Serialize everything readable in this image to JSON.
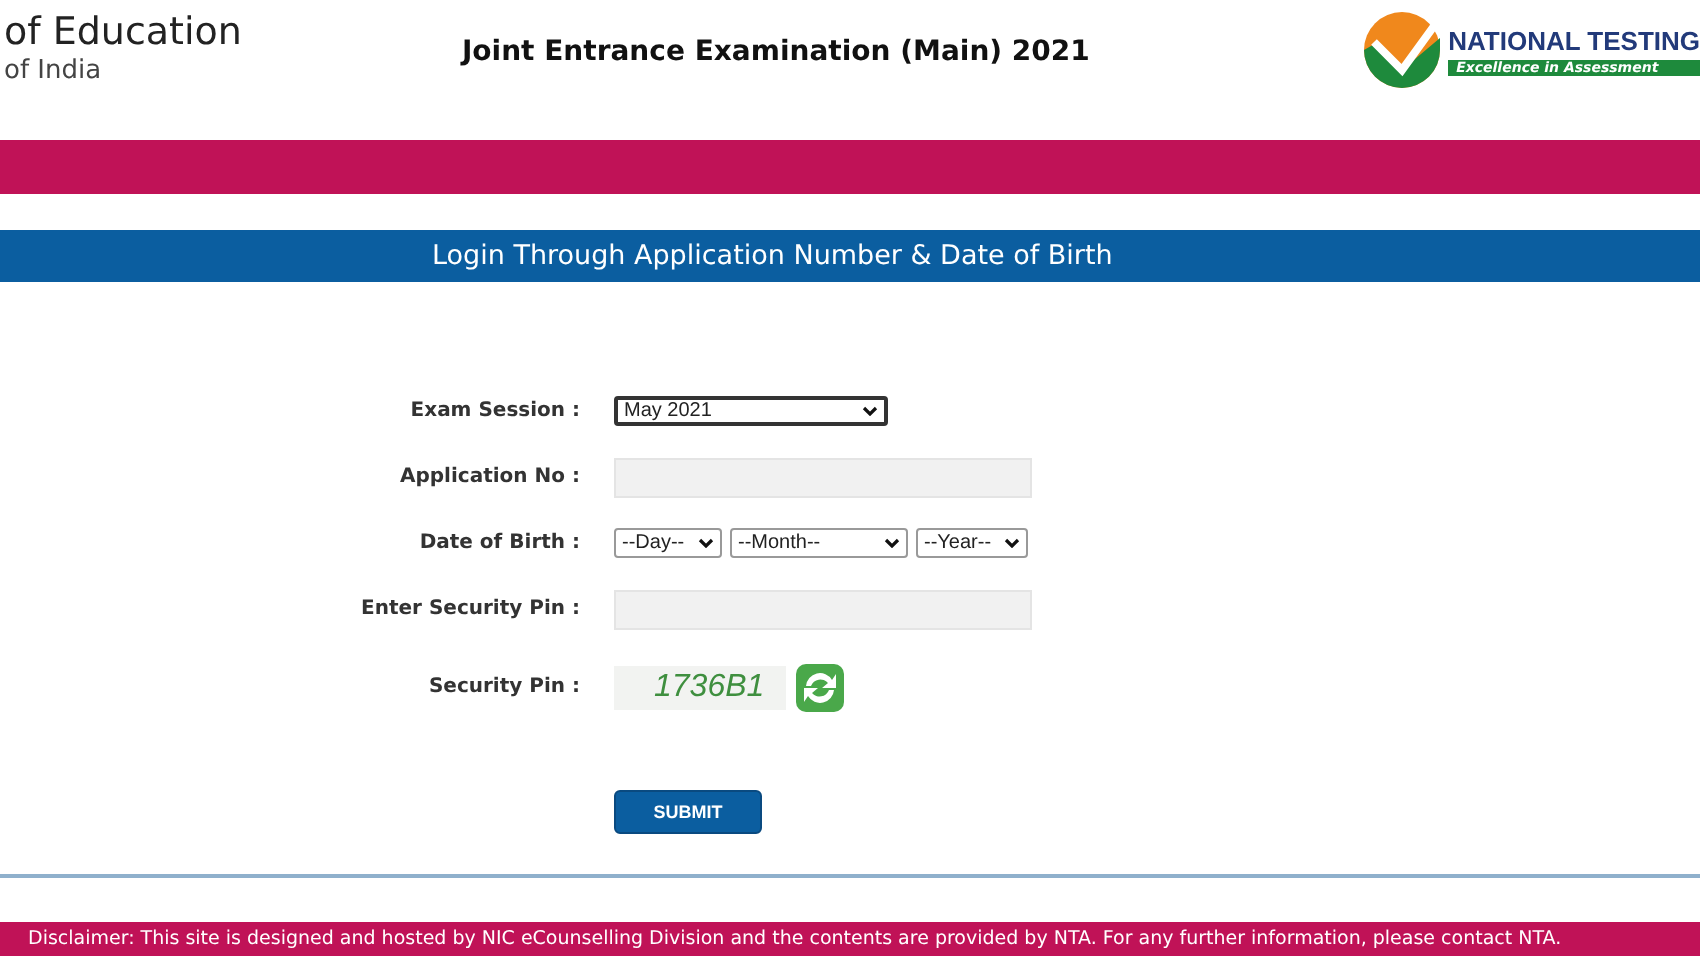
{
  "header": {
    "ministry_line1": "of Education",
    "ministry_line2": "of India",
    "title": "Joint Entrance Examination (Main) 2021",
    "logo_name": "NATIONAL TESTING",
    "logo_tagline": "Excellence in Assessment"
  },
  "form_title": "Login Through Application Number & Date of Birth",
  "form": {
    "exam_session": {
      "label": "Exam Session :",
      "value": "May 2021"
    },
    "application_no": {
      "label": "Application No :"
    },
    "dob": {
      "label": "Date of Birth :",
      "day": "--Day--",
      "month": "--Month--",
      "year": "--Year--"
    },
    "enter_pin": {
      "label": "Enter Security Pin :"
    },
    "security_pin": {
      "label": "Security Pin :",
      "captcha": "1736B1"
    },
    "submit": "SUBMIT"
  },
  "footer": "Disclaimer: This site is designed and hosted by NIC eCounselling Division and the contents are provided by NTA. For any further information, please contact NTA."
}
